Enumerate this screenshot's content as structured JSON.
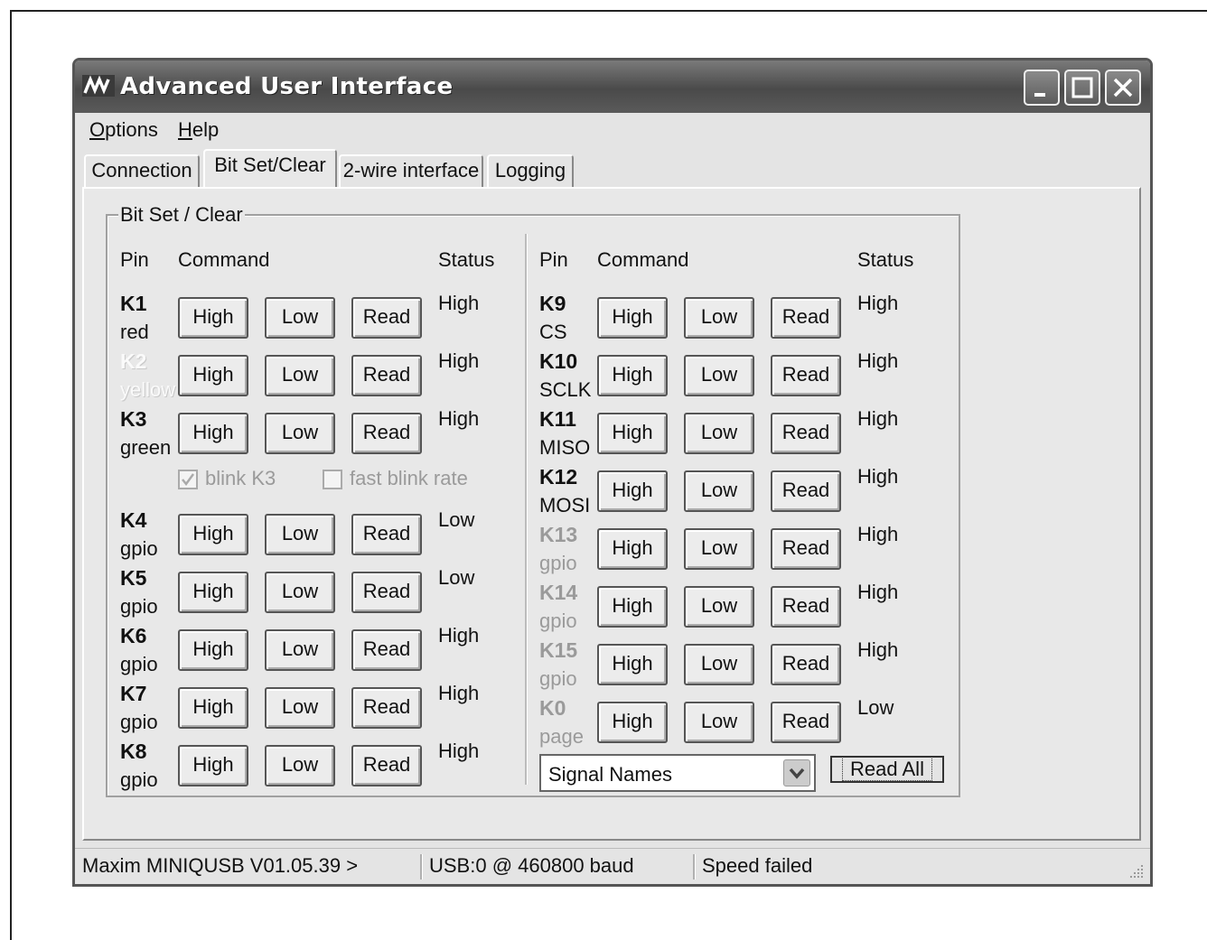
{
  "window": {
    "title": "Advanced User Interface"
  },
  "menu": {
    "options": "Options",
    "help": "Help"
  },
  "tabs": [
    {
      "label": "Connection"
    },
    {
      "label": "Bit Set/Clear"
    },
    {
      "label": "2-wire interface"
    },
    {
      "label": "Logging"
    }
  ],
  "group": {
    "title": "Bit Set / Clear",
    "hdr_pin": "Pin",
    "hdr_command": "Command",
    "hdr_status": "Status"
  },
  "buttons": {
    "high": "High",
    "low": "Low",
    "read": "Read"
  },
  "left_pins": [
    {
      "name": "K1",
      "sub": "red",
      "status": "High",
      "state": "normal"
    },
    {
      "name": "K2",
      "sub": "yellow",
      "status": "High",
      "state": "disabled"
    },
    {
      "name": "K3",
      "sub": "green",
      "status": "High",
      "state": "normal"
    },
    {
      "name": "K4",
      "sub": "gpio",
      "status": "Low",
      "state": "normal"
    },
    {
      "name": "K5",
      "sub": "gpio",
      "status": "Low",
      "state": "normal"
    },
    {
      "name": "K6",
      "sub": "gpio",
      "status": "High",
      "state": "normal"
    },
    {
      "name": "K7",
      "sub": "gpio",
      "status": "High",
      "state": "normal"
    },
    {
      "name": "K8",
      "sub": "gpio",
      "status": "High",
      "state": "normal"
    }
  ],
  "right_pins": [
    {
      "name": "K9",
      "sub": "CS",
      "status": "High",
      "state": "normal"
    },
    {
      "name": "K10",
      "sub": "SCLK",
      "status": "High",
      "state": "normal"
    },
    {
      "name": "K11",
      "sub": "MISO",
      "status": "High",
      "state": "normal"
    },
    {
      "name": "K12",
      "sub": "MOSI",
      "status": "High",
      "state": "normal"
    },
    {
      "name": "K13",
      "sub": "gpio",
      "status": "High",
      "state": "gray"
    },
    {
      "name": "K14",
      "sub": "gpio",
      "status": "High",
      "state": "gray"
    },
    {
      "name": "K15",
      "sub": "gpio",
      "status": "High",
      "state": "gray"
    },
    {
      "name": "K0",
      "sub": "page",
      "status": "Low",
      "state": "gray"
    }
  ],
  "checkboxes": {
    "blink": {
      "label": "blink K3",
      "checked": true
    },
    "fast": {
      "label": "fast blink rate",
      "checked": false
    }
  },
  "signal_select": {
    "value": "Signal Names"
  },
  "read_all": "Read All",
  "statusbar": {
    "device": "Maxim MINIQUSB V01.05.39 >",
    "port": "USB:0 @ 460800 baud",
    "message": "Speed failed"
  }
}
